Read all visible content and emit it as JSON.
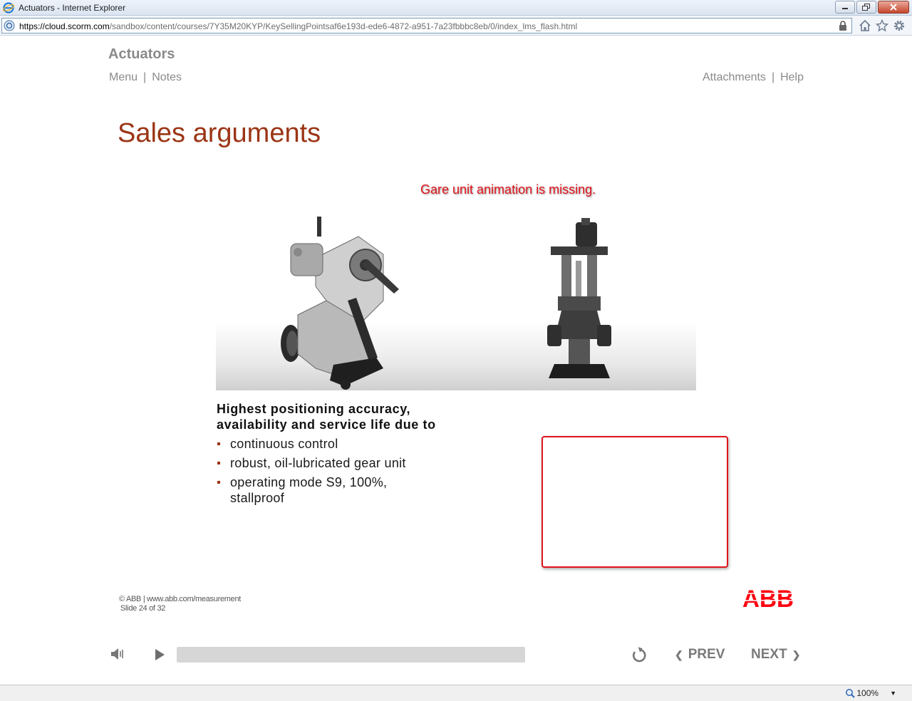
{
  "window": {
    "title": "Actuators - Internet Explorer",
    "url_host": "https://cloud.scorm.com",
    "url_path": "/sandbox/content/courses/7Y35M20KYP/KeySellingPointsaf6e193d-ede6-4872-a951-7a23fbbbc8eb/0/index_lms_flash.html"
  },
  "player": {
    "course_title": "Actuators",
    "menu_label": "Menu",
    "notes_label": "Notes",
    "attachments_label": "Attachments",
    "help_label": "Help",
    "divider": "|",
    "prev_label": "PREV",
    "next_label": "NEXT",
    "progress": 0
  },
  "slide": {
    "title": "Sales arguments",
    "note": "Gare unit animation is missing.",
    "headline_line1": "Highest positioning accuracy,",
    "headline_line2": "availability and service life due to",
    "bullets": [
      "continuous control",
      "robust, oil-lubricated gear unit",
      "operating mode S9, 100%, stallproof"
    ],
    "copyright": "© ABB | www.abb.com/measurement",
    "slide_counter": "Slide 24 of 32",
    "logo_text": "ABB"
  },
  "status": {
    "zoom": "100%"
  },
  "colors": {
    "title_red": "#9b3515",
    "note_red": "#e0141c",
    "abb_red": "#ff000f",
    "gray_text": "#8a8a8a"
  },
  "icons": [
    "ie-logo-icon",
    "minimize-icon",
    "restore-icon",
    "close-icon",
    "lock-icon",
    "home-icon",
    "favorites-star-icon",
    "gear-icon",
    "volume-icon",
    "play-icon",
    "replay-icon",
    "chevron-left-icon",
    "chevron-right-icon",
    "zoom-icon"
  ]
}
